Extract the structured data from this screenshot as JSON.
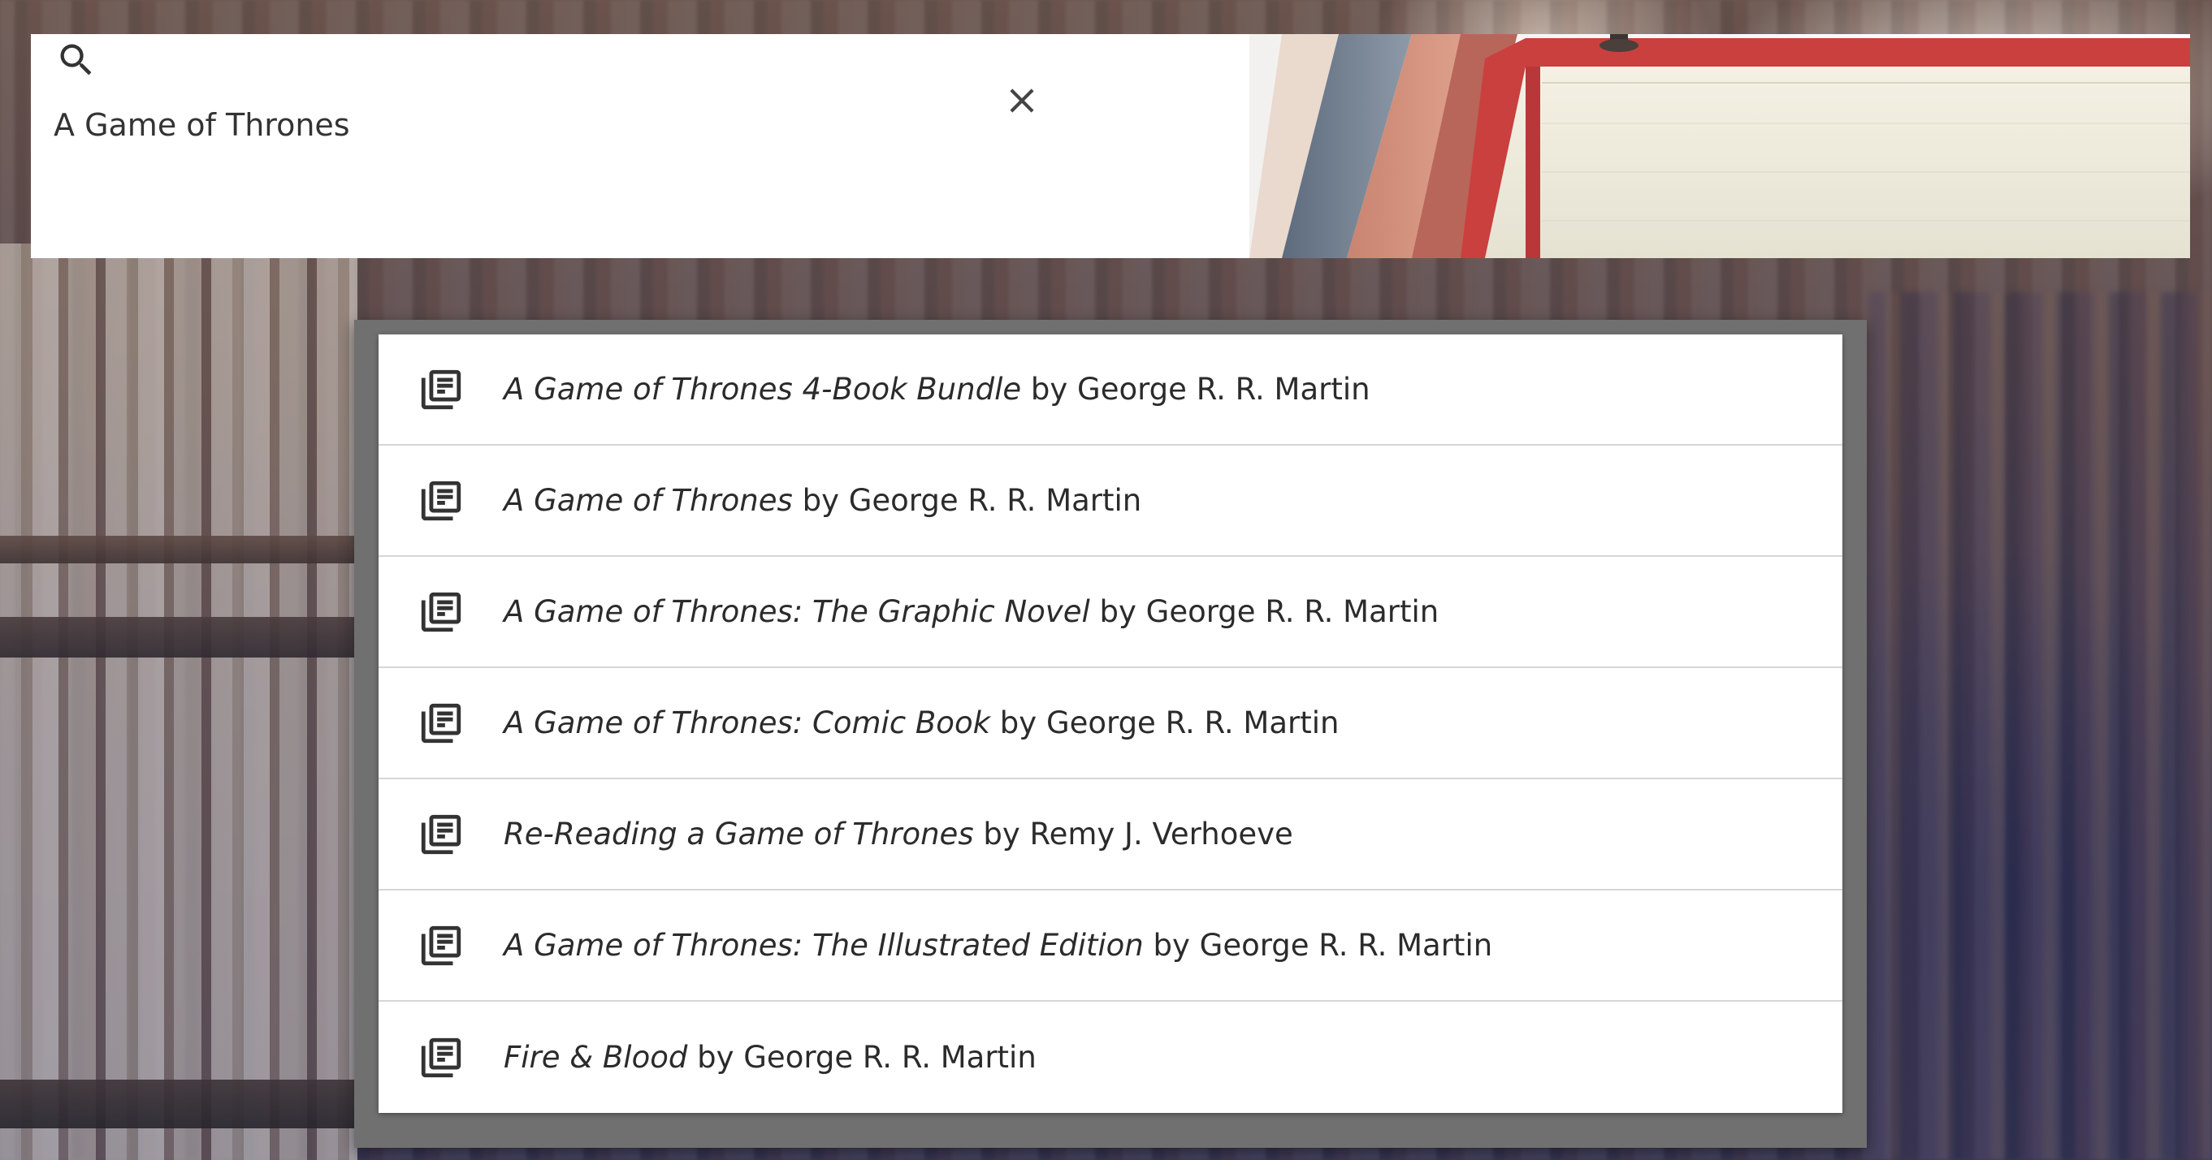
{
  "search": {
    "query": "A Game of Thrones",
    "icon": "search-icon",
    "clear_icon": "close-icon"
  },
  "results": [
    {
      "title": "A Game of Thrones 4-Book Bundle",
      "by": "by",
      "author": "George R. R. Martin",
      "icon": "library-books-icon"
    },
    {
      "title": "A Game of Thrones",
      "by": "by",
      "author": "George R. R. Martin",
      "icon": "library-books-icon"
    },
    {
      "title": "A Game of Thrones: The Graphic Novel",
      "by": "by",
      "author": "George R. R. Martin",
      "icon": "library-books-icon"
    },
    {
      "title": "A Game of Thrones: Comic Book",
      "by": "by",
      "author": "George R. R. Martin",
      "icon": "library-books-icon"
    },
    {
      "title": "Re-Reading a Game of Thrones",
      "by": "by",
      "author": "Remy J. Verhoeve",
      "icon": "library-books-icon"
    },
    {
      "title": "A Game of Thrones: The Illustrated Edition",
      "by": "by",
      "author": "George R. R. Martin",
      "icon": "library-books-icon"
    },
    {
      "title": "Fire & Blood",
      "by": "by",
      "author": "George R. R. Martin",
      "icon": "library-books-icon"
    }
  ],
  "colors": {
    "panel": "#707070",
    "text": "#2b2b2b",
    "divider": "#d6d6d6",
    "header_bg": "#ffffff"
  }
}
